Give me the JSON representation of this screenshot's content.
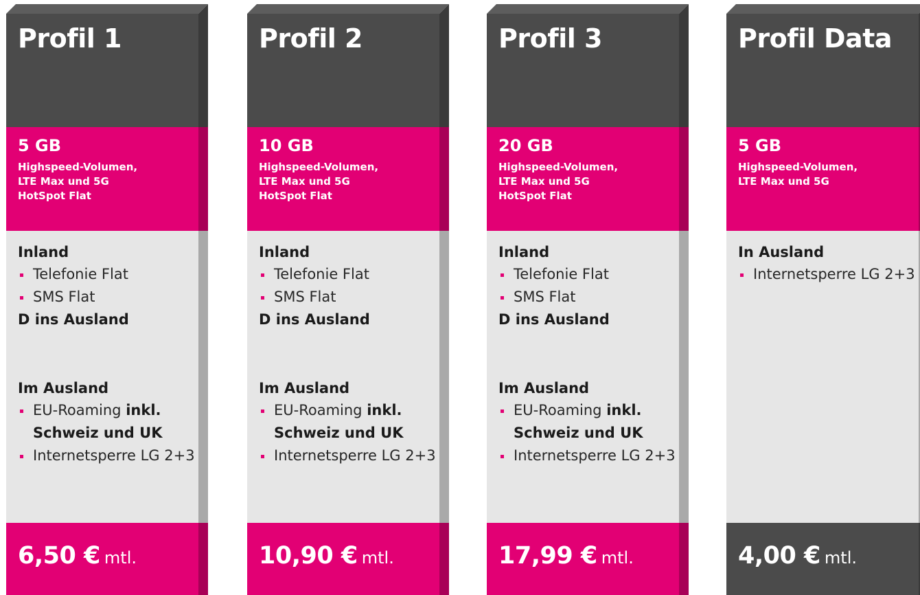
{
  "cards": [
    {
      "title": "Profil 1",
      "volume": "5 GB",
      "volume_lines": [
        "Highspeed-Volumen,",
        "LTE Max und 5G",
        "HotSpot Flat"
      ],
      "inland_heading": "Inland",
      "inland_items": [
        "Telefonie Flat",
        "SMS Flat"
      ],
      "d_ins_ausland": "D ins Ausland",
      "ausland_heading": "Im Ausland",
      "roaming_prefix": "EU-Roaming",
      "roaming_bold": "inkl.",
      "roaming_bold2": "Schweiz und UK",
      "sperre": "Internetsperre LG 2+3",
      "price": "6,50 €",
      "unit": "mtl."
    },
    {
      "title": "Profil 2",
      "volume": "10 GB",
      "volume_lines": [
        "Highspeed-Volumen,",
        "LTE Max und 5G",
        "HotSpot Flat"
      ],
      "inland_heading": "Inland",
      "inland_items": [
        "Telefonie Flat",
        "SMS Flat"
      ],
      "d_ins_ausland": "D ins Ausland",
      "ausland_heading": "Im Ausland",
      "roaming_prefix": "EU-Roaming",
      "roaming_bold": "inkl.",
      "roaming_bold2": "Schweiz und UK",
      "sperre": "Internetsperre LG 2+3",
      "price": "10,90 €",
      "unit": "mtl."
    },
    {
      "title": "Profil 3",
      "volume": "20 GB",
      "volume_lines": [
        "Highspeed-Volumen,",
        "LTE Max und 5G",
        "HotSpot Flat"
      ],
      "inland_heading": "Inland",
      "inland_items": [
        "Telefonie Flat",
        "SMS Flat"
      ],
      "d_ins_ausland": "D ins Ausland",
      "ausland_heading": "Im Ausland",
      "roaming_prefix": "EU-Roaming",
      "roaming_bold": "inkl.",
      "roaming_bold2": "Schweiz und UK",
      "sperre": "Internetsperre LG 2+3",
      "price": "17,99 €",
      "unit": "mtl."
    },
    {
      "title": "Profil Data",
      "volume": "5 GB",
      "volume_lines": [
        "Highspeed-Volumen,",
        "LTE Max und 5G"
      ],
      "ausland_heading": "In Ausland",
      "sperre": "Internetsperre LG 2+3",
      "price": "4,00 €",
      "unit": "mtl."
    }
  ],
  "colors": {
    "magenta": "#e20074",
    "dark_grey": "#4b4b4b",
    "light_grey": "#e6e6e6"
  }
}
